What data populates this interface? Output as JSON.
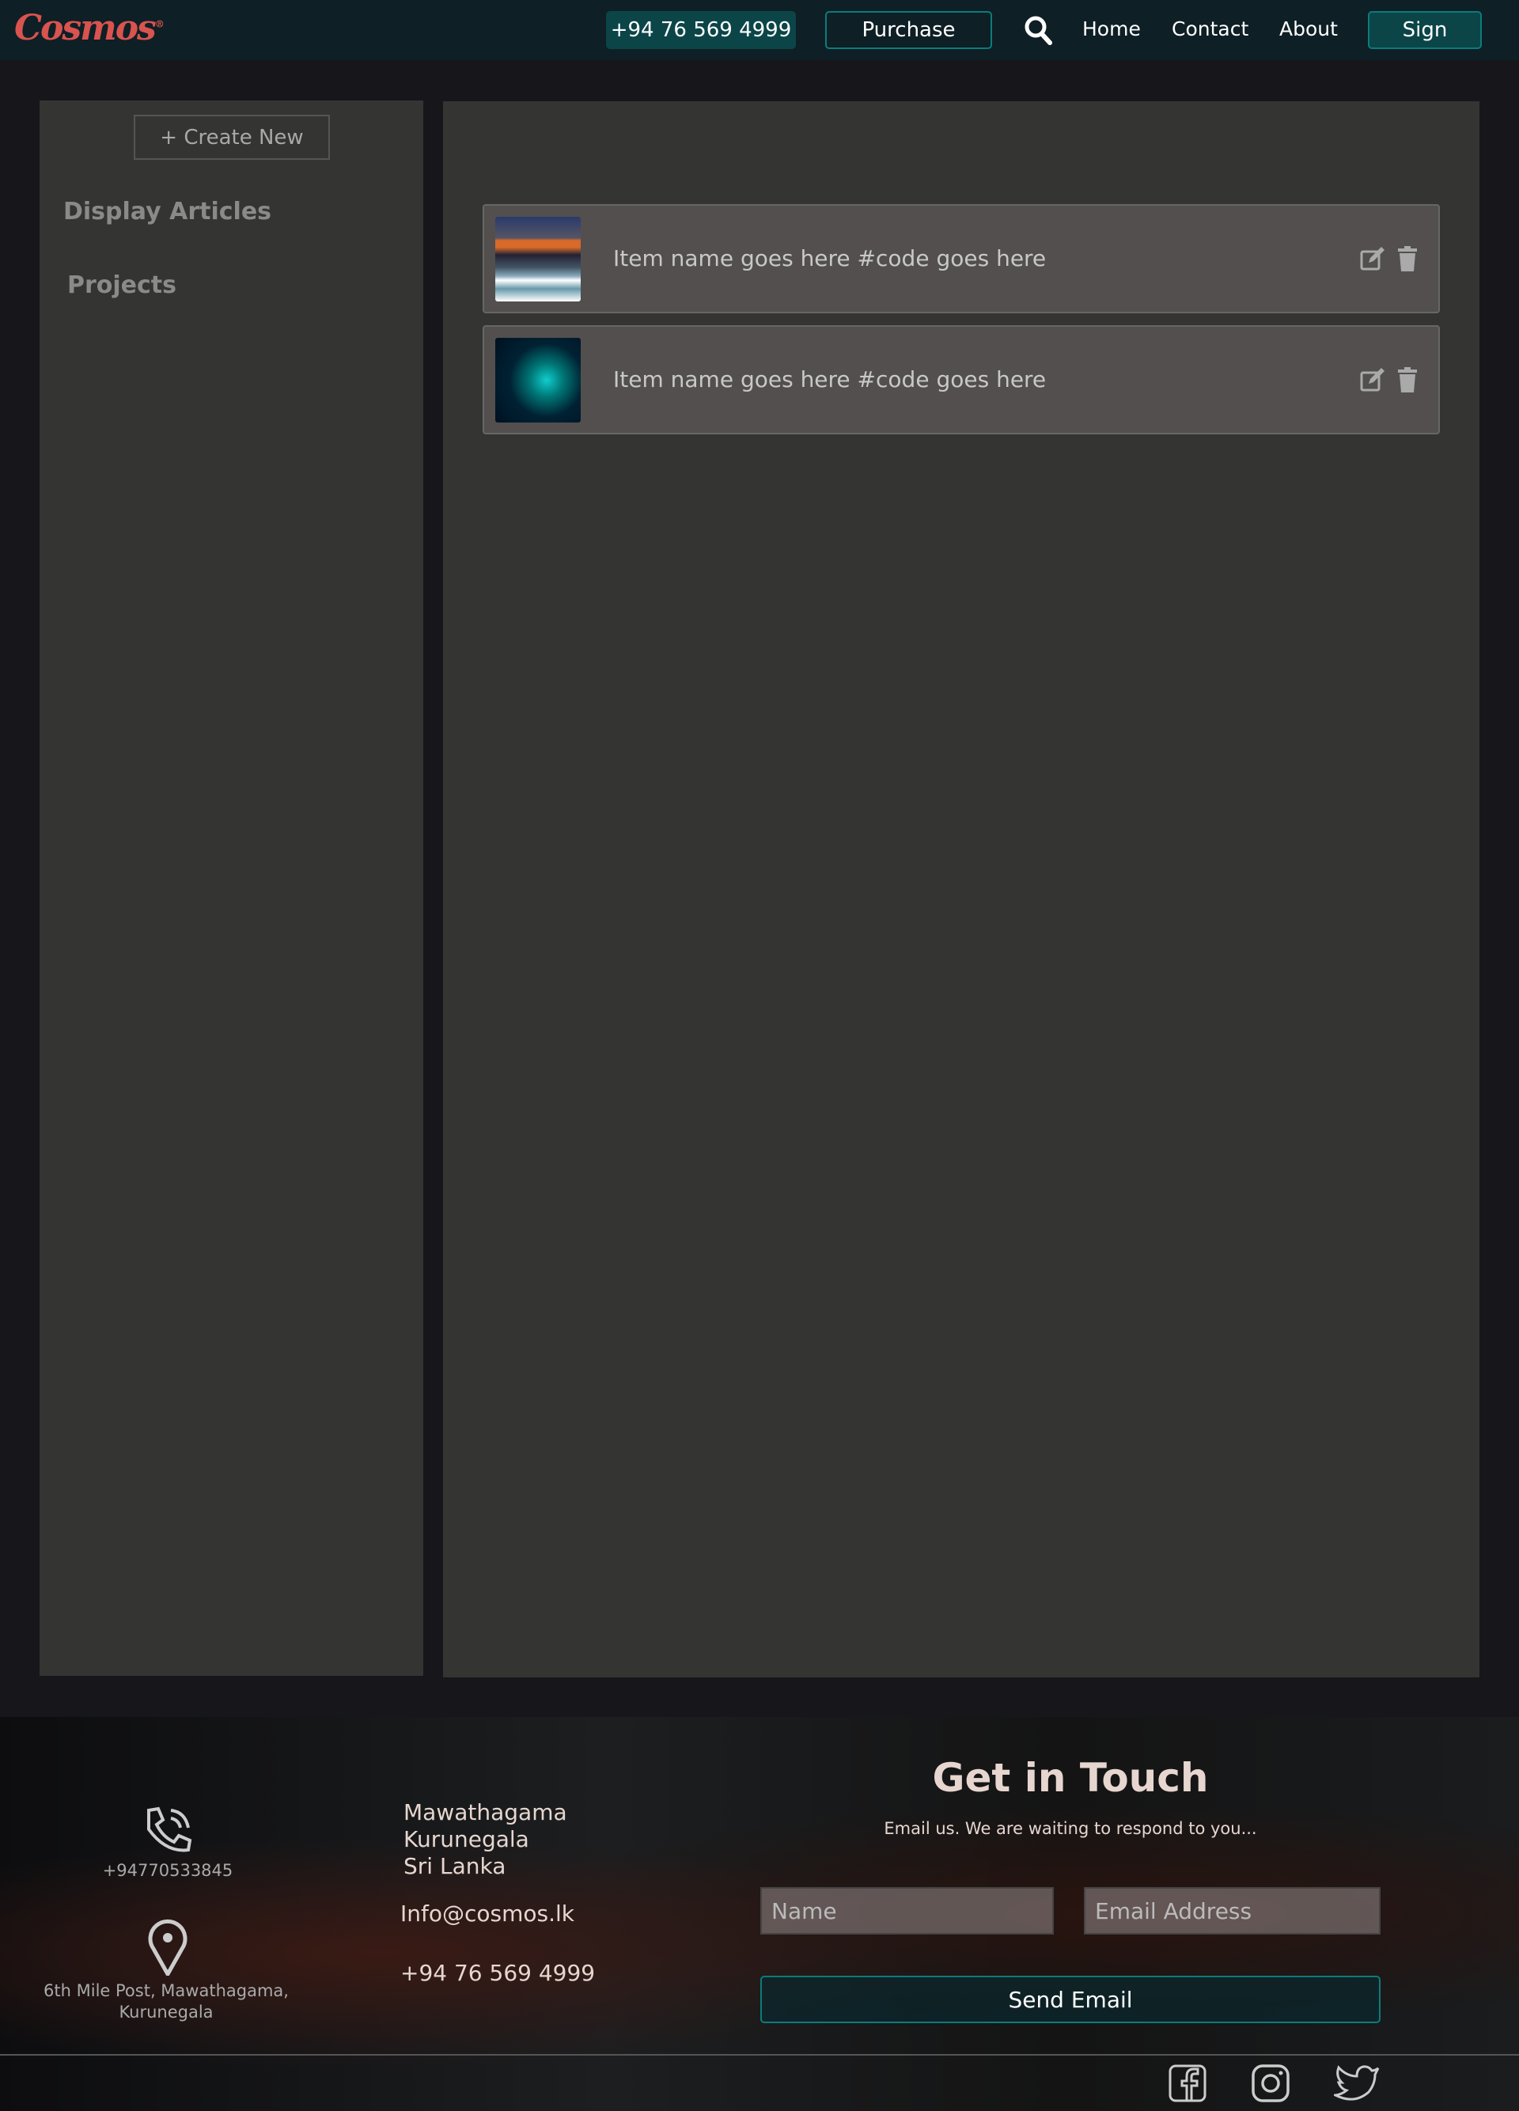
{
  "header": {
    "logo": "Cosmos",
    "logo_mark": "®",
    "phone": "+94 76 569 4999",
    "purchase": "Purchase",
    "nav": [
      "Home",
      "Contact",
      "About"
    ],
    "sign": "Sign"
  },
  "sidebar": {
    "create_new": "+ Create New",
    "items": [
      "Display Articles",
      "Projects"
    ]
  },
  "items": [
    {
      "label": "Item name goes here #code goes here"
    },
    {
      "label": "Item name goes here #code goes here"
    }
  ],
  "footer": {
    "phone_small": "+94770533845",
    "address_small_1": "6th Mile Post, Mawathagama,",
    "address_small_2": "Kurunegala",
    "address_lines": [
      "Mawathagama",
      "Kurunegala",
      "Sri Lanka"
    ],
    "email": "Info@cosmos.lk",
    "phone": "+94 76 569 4999",
    "title": "Get in Touch",
    "subtitle": "Email us. We are waiting to respond to you...",
    "name_placeholder": "Name",
    "email_placeholder": "Email Address",
    "send": "Send Email"
  }
}
